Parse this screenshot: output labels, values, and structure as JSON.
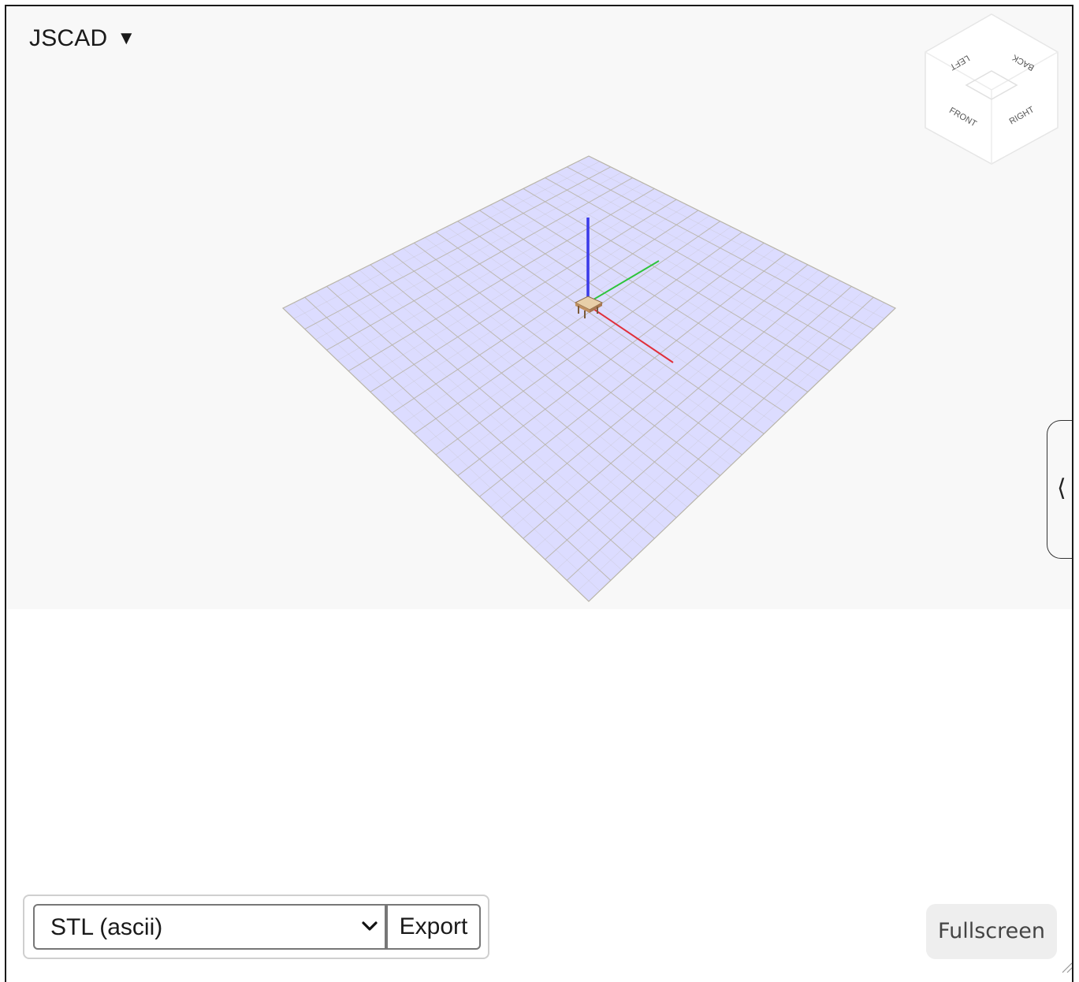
{
  "app_menu": {
    "label": "JSCAD",
    "caret": "▼"
  },
  "view_cube": {
    "faces": [
      "LEFT",
      "BACK",
      "FRONT",
      "RIGHT"
    ]
  },
  "side_panel_toggle": {
    "glyph": "⟨"
  },
  "export": {
    "format_selected": "STL (ascii)",
    "button_label": "Export"
  },
  "fullscreen": {
    "label": "Fullscreen"
  },
  "colors": {
    "viewport_bg": "#f8f8f8",
    "grid_fill": "#dcdcff",
    "grid_line": "#b8b4a8",
    "axis_x": "#e0303a",
    "axis_y": "#2ec43a",
    "axis_z": "#3a3ae8",
    "model": "#d8b088"
  },
  "icons": {
    "menu_caret": "triangle-down-icon",
    "select_chevron": "chevron-down-icon",
    "side_toggle": "chevron-left-icon",
    "resize": "resize-grip-icon"
  }
}
